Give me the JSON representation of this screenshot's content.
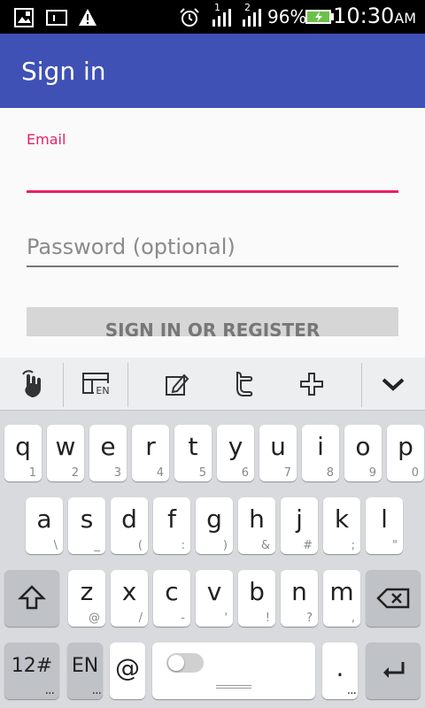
{
  "status_bar": {
    "signal_1_label": "1",
    "signal_2_label": "2",
    "battery_percent": "96%",
    "time": "10:30",
    "ampm": "AM",
    "icons": [
      "image-icon",
      "sim-card-icon",
      "warning-icon",
      "alarm-icon",
      "signal-icon",
      "signal-icon",
      "battery-charging-icon"
    ]
  },
  "app_bar": {
    "title": "Sign in"
  },
  "form": {
    "email_label": "Email",
    "email_value": "",
    "password_placeholder": "Password (optional)",
    "submit_label": "SIGN IN OR REGISTER"
  },
  "keyboard": {
    "toolbar": {
      "items": [
        "gesture-icon",
        "layout-language-icon",
        "edit-icon",
        "twitter-icon",
        "plus-icon",
        "collapse-icon"
      ],
      "layout_label": "EN"
    },
    "row1": [
      {
        "main": "q",
        "sub": "1"
      },
      {
        "main": "w",
        "sub": "2"
      },
      {
        "main": "e",
        "sub": "3"
      },
      {
        "main": "r",
        "sub": "4"
      },
      {
        "main": "t",
        "sub": "5"
      },
      {
        "main": "y",
        "sub": "6"
      },
      {
        "main": "u",
        "sub": "7"
      },
      {
        "main": "i",
        "sub": "8"
      },
      {
        "main": "o",
        "sub": "9"
      },
      {
        "main": "p",
        "sub": "0"
      }
    ],
    "row2": [
      {
        "main": "a",
        "sub": "\\"
      },
      {
        "main": "s",
        "sub": "_"
      },
      {
        "main": "d",
        "sub": "("
      },
      {
        "main": "f",
        "sub": ":"
      },
      {
        "main": "g",
        "sub": ")"
      },
      {
        "main": "h",
        "sub": "&"
      },
      {
        "main": "j",
        "sub": "#"
      },
      {
        "main": "k",
        "sub": ";"
      },
      {
        "main": "l",
        "sub": "\""
      }
    ],
    "row3": [
      {
        "main": "z",
        "sub": "@"
      },
      {
        "main": "x",
        "sub": "/"
      },
      {
        "main": "c",
        "sub": "-"
      },
      {
        "main": "v",
        "sub": "'"
      },
      {
        "main": "b",
        "sub": "!"
      },
      {
        "main": "n",
        "sub": "?"
      },
      {
        "main": "m",
        "sub": ","
      }
    ],
    "bottom": {
      "symbols_label": "12#",
      "lang_label": "EN",
      "at_label": "@",
      "period_label": ".",
      "dots": "..."
    }
  }
}
